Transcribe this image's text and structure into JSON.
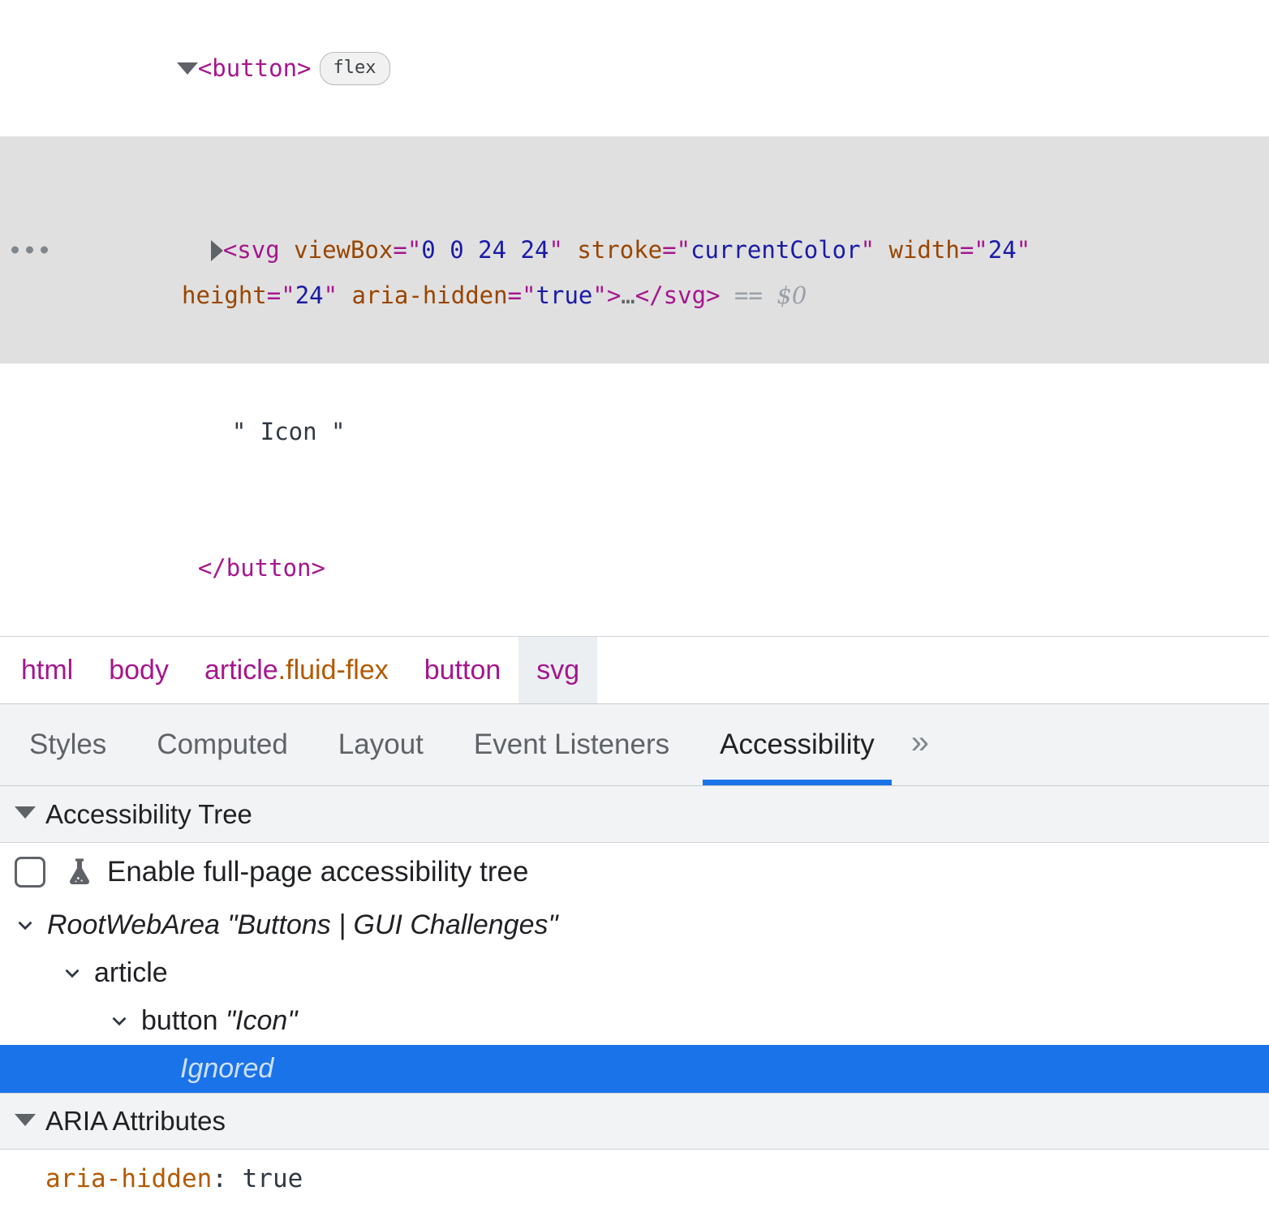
{
  "dom_tree": {
    "lines": [
      {
        "id": "button-open",
        "disclosure": "triangle-down",
        "tag": "<button>",
        "badge": "flex"
      },
      {
        "id": "svg-node",
        "selected": true,
        "more_label": "…",
        "disclosure": "triangle-right",
        "tag_open": "<svg",
        "attrs": [
          {
            "name": "viewBox",
            "value": "0 0 24 24"
          },
          {
            "name": "stroke",
            "value": "currentColor"
          },
          {
            "name": "width",
            "value": "24"
          },
          {
            "name": "height",
            "value": "24"
          },
          {
            "name": "aria-hidden",
            "value": "true"
          }
        ],
        "collapsed_children": "…",
        "tag_close": "</svg>",
        "console_ref_eq": "==",
        "console_ref": "$0"
      },
      {
        "id": "text-node",
        "text": "\" Icon \""
      },
      {
        "id": "button-close",
        "tag": "</button>"
      }
    ]
  },
  "breadcrumb": {
    "items": [
      {
        "label": "html",
        "class_part": "",
        "active": false
      },
      {
        "label": "body",
        "class_part": "",
        "active": false
      },
      {
        "label": "article",
        "class_part": ".fluid-flex",
        "active": false
      },
      {
        "label": "button",
        "class_part": "",
        "active": false
      },
      {
        "label": "svg",
        "class_part": "",
        "active": true
      }
    ]
  },
  "tabs": {
    "items": [
      {
        "label": "Styles",
        "active": false
      },
      {
        "label": "Computed",
        "active": false
      },
      {
        "label": "Layout",
        "active": false
      },
      {
        "label": "Event Listeners",
        "active": false
      },
      {
        "label": "Accessibility",
        "active": true
      }
    ],
    "overflow_icon": "»",
    "accent_color": "#1a73e8"
  },
  "accessibility_tree": {
    "section_title": "Accessibility Tree",
    "full_page_toggle": {
      "label": "Enable full-page accessibility tree",
      "checked": false,
      "icon": "experiment-flask-icon"
    },
    "nodes": [
      {
        "indent": 0,
        "expanded": true,
        "role": "RootWebArea",
        "name": "\"Buttons | GUI Challenges\"",
        "italic_role": true,
        "selected": false
      },
      {
        "indent": 1,
        "expanded": true,
        "role": "article",
        "name": "",
        "italic_role": false,
        "selected": false
      },
      {
        "indent": 2,
        "expanded": true,
        "role": "button",
        "name": "\"Icon\"",
        "italic_role": false,
        "selected": false
      },
      {
        "indent": 3,
        "expanded": false,
        "role": "Ignored",
        "name": "",
        "italic_role": true,
        "selected": true
      }
    ]
  },
  "aria_attributes": {
    "section_title": "ARIA Attributes",
    "rows": [
      {
        "name": "aria-hidden",
        "separator": ": ",
        "value": "true"
      }
    ]
  },
  "colors": {
    "selection_blue": "#1a73e8",
    "dom_selection_gray": "#e0e0e0",
    "tag_magenta": "#a5168e",
    "attr_brown": "#994500",
    "value_blue": "#1a1aa6",
    "panel_gray": "#f1f3f4"
  }
}
